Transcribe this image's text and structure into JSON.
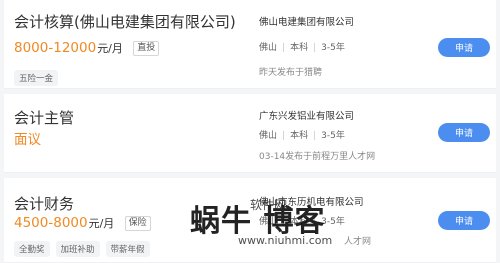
{
  "jobs": [
    {
      "title": "会计核算(佛山电建集团有限公司)",
      "salary": "8000-12000",
      "salary_unit": "元/月",
      "badge": "直投",
      "tags": [
        "五险一金"
      ],
      "company": "佛山电建集团有限公司",
      "location": "佛山",
      "education": "本科",
      "experience": "3-5年",
      "published": "昨天发布于猎聘",
      "apply_label": "申请"
    },
    {
      "title": "会计主管",
      "salary": "面议",
      "salary_unit": "",
      "badge": "",
      "tags": [],
      "company": "广东兴发铝业有限公司",
      "location": "佛山",
      "education": "本科",
      "experience": "3-5年",
      "published": "03-14发布于前程万里人才网",
      "apply_label": "申请"
    },
    {
      "title": "会计财务",
      "salary": "4500-8000",
      "salary_unit": "元/月",
      "badge": "保险",
      "tags": [
        "全勤奖",
        "加班补助",
        "带薪年假"
      ],
      "company": "佛山市东历机电有限公司",
      "location": "佛山",
      "education": "本科",
      "experience": "3-5年",
      "published": "人才网",
      "apply_label": "申请"
    }
  ],
  "watermark": {
    "main": "蜗牛 博客",
    "sub": "软件网",
    "url": "www.niuhmi.com"
  },
  "colors": {
    "salary": "#f08a24",
    "apply_button": "#4c8ef0",
    "background": "#f4f5f7"
  }
}
